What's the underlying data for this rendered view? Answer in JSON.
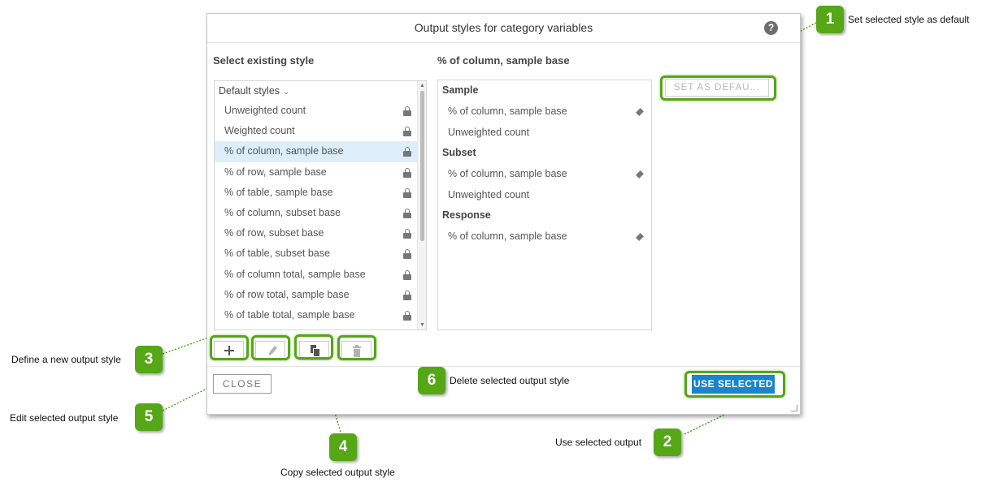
{
  "dialog": {
    "title": "Output styles for category variables",
    "help_glyph": "?",
    "left_section_title": "Select existing style",
    "right_section_title": "% of column, sample base",
    "style_list": {
      "group_label": "Default styles",
      "items": [
        {
          "label": "Unweighted count",
          "locked": true
        },
        {
          "label": "Weighted count",
          "locked": true
        },
        {
          "label": "% of column, sample base",
          "locked": true,
          "selected": true
        },
        {
          "label": "% of row, sample base",
          "locked": true
        },
        {
          "label": "% of table, sample base",
          "locked": true
        },
        {
          "label": "% of column, subset base",
          "locked": true
        },
        {
          "label": "% of row, subset base",
          "locked": true
        },
        {
          "label": "% of table, subset base",
          "locked": true
        },
        {
          "label": "% of column total, sample base",
          "locked": true
        },
        {
          "label": "% of row total, sample base",
          "locked": true
        },
        {
          "label": "% of table total, sample base",
          "locked": true
        }
      ]
    },
    "detail": {
      "groups": [
        {
          "name": "Sample",
          "items": [
            {
              "label": "% of column, sample base",
              "marker": true
            },
            {
              "label": "Unweighted count",
              "marker": false
            }
          ]
        },
        {
          "name": "Subset",
          "items": [
            {
              "label": "% of column, sample base",
              "marker": true
            },
            {
              "label": "Unweighted count",
              "marker": false
            }
          ]
        },
        {
          "name": "Response",
          "items": [
            {
              "label": "% of column, sample base",
              "marker": true
            }
          ]
        }
      ]
    },
    "set_default_label": "SET AS DEFAU...",
    "close_label": "CLOSE",
    "use_selected_label": "USE SELECTED",
    "toolbar_icons": [
      "plus-icon",
      "pencil-icon",
      "copy-icon",
      "trash-icon"
    ]
  },
  "callouts": [
    {
      "number": "1",
      "text": "Set selected style as default"
    },
    {
      "number": "2",
      "text": "Use selected output"
    },
    {
      "number": "3",
      "text": "Define a new output style"
    },
    {
      "number": "4",
      "text": "Copy selected output style"
    },
    {
      "number": "5",
      "text": "Edit selected output style"
    },
    {
      "number": "6",
      "text": "Delete selected output style"
    }
  ],
  "colors": {
    "accent": "#1b85c9",
    "highlight": "#57a519",
    "badge": "#55a716",
    "selected_row": "#ddeefa"
  }
}
